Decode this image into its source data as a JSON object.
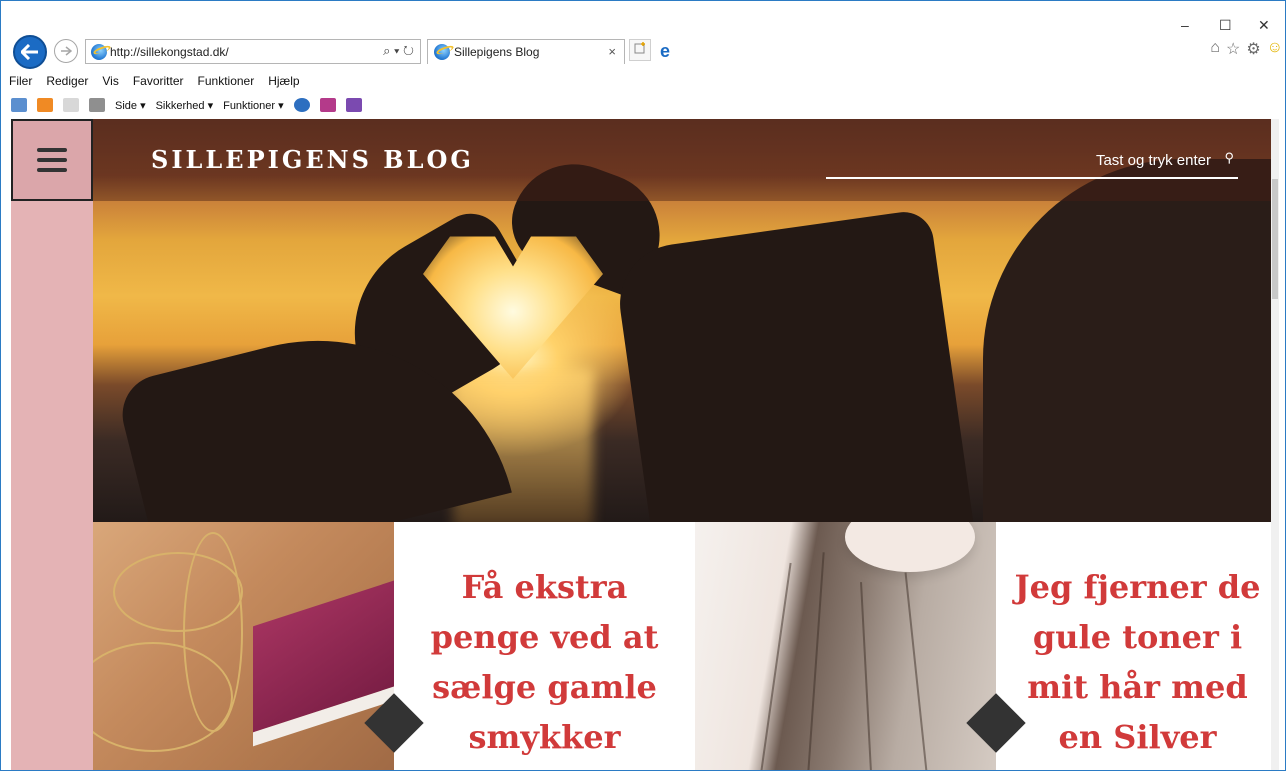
{
  "browser": {
    "url": "http://sillekongstad.dk/",
    "tab_title": "Sillepigens Blog",
    "tab_close": "×",
    "addr_search": "⌕ ▾ ↻",
    "window_minimize": "–",
    "window_maximize": "☐",
    "window_close": "✕"
  },
  "menu": [
    "Filer",
    "Rediger",
    "Vis",
    "Favoritter",
    "Funktioner",
    "Hjælp"
  ],
  "commandbar": {
    "side": "Side ▾",
    "sikkerhed": "Sikkerhed ▾",
    "funktioner": "Funktioner ▾"
  },
  "site": {
    "title": "SILLEPIGENS BLOG",
    "search_placeholder": "Tast og tryk enter",
    "search_icon": "⚲"
  },
  "posts": [
    {
      "title": "Få ekstra penge ved at sælge gamle smykker"
    },
    {
      "title": "Jeg fjerner de gule toner i mit hår med en Silver"
    }
  ],
  "colors": {
    "accent": "#d13a3a",
    "sidebar": "#e4b3b5",
    "ie_blue": "#1b6bc4"
  }
}
